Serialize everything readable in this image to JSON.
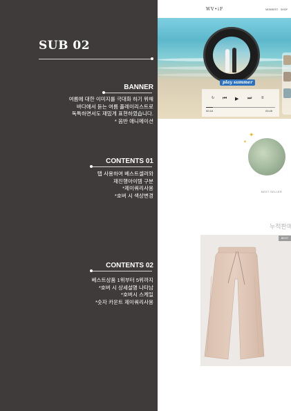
{
  "left_panel": {
    "title": "SUB 02",
    "sections": [
      {
        "heading": "BANNER",
        "lines": [
          "여름에 대한 이미지를 극대화 하기 위해",
          "바다에서 듣는 여름 플레이리스트로",
          "독특하면서도 재밌게 표현하였습니다.",
          "* 음반 애니메이션"
        ]
      },
      {
        "heading": "CONTENTS 01",
        "lines": [
          "탭 사용하여 베스트셀러와",
          "재진행아이템 구분",
          "*제이쿼리사용",
          "*호버 시 색상변경"
        ]
      },
      {
        "heading": "CONTENTS 02",
        "lines": [
          "베스트상품 1위부터 5위까지",
          "*호버 시 상세설명 나타남",
          "*호버시 스케일",
          "*숫자 카운트 제이쿼리사용"
        ]
      }
    ]
  },
  "preview": {
    "logo": "WV•iF",
    "nav": [
      "NEW/BEST",
      "SHOP"
    ],
    "banner": {
      "play_label": "play summer",
      "time_start": "00:16",
      "time_end": "03:45",
      "progress": 0.1
    },
    "contents01": {
      "label": "BEST SELLER"
    },
    "contents02": {
      "tag": "BEST",
      "title": "누적판매"
    }
  }
}
